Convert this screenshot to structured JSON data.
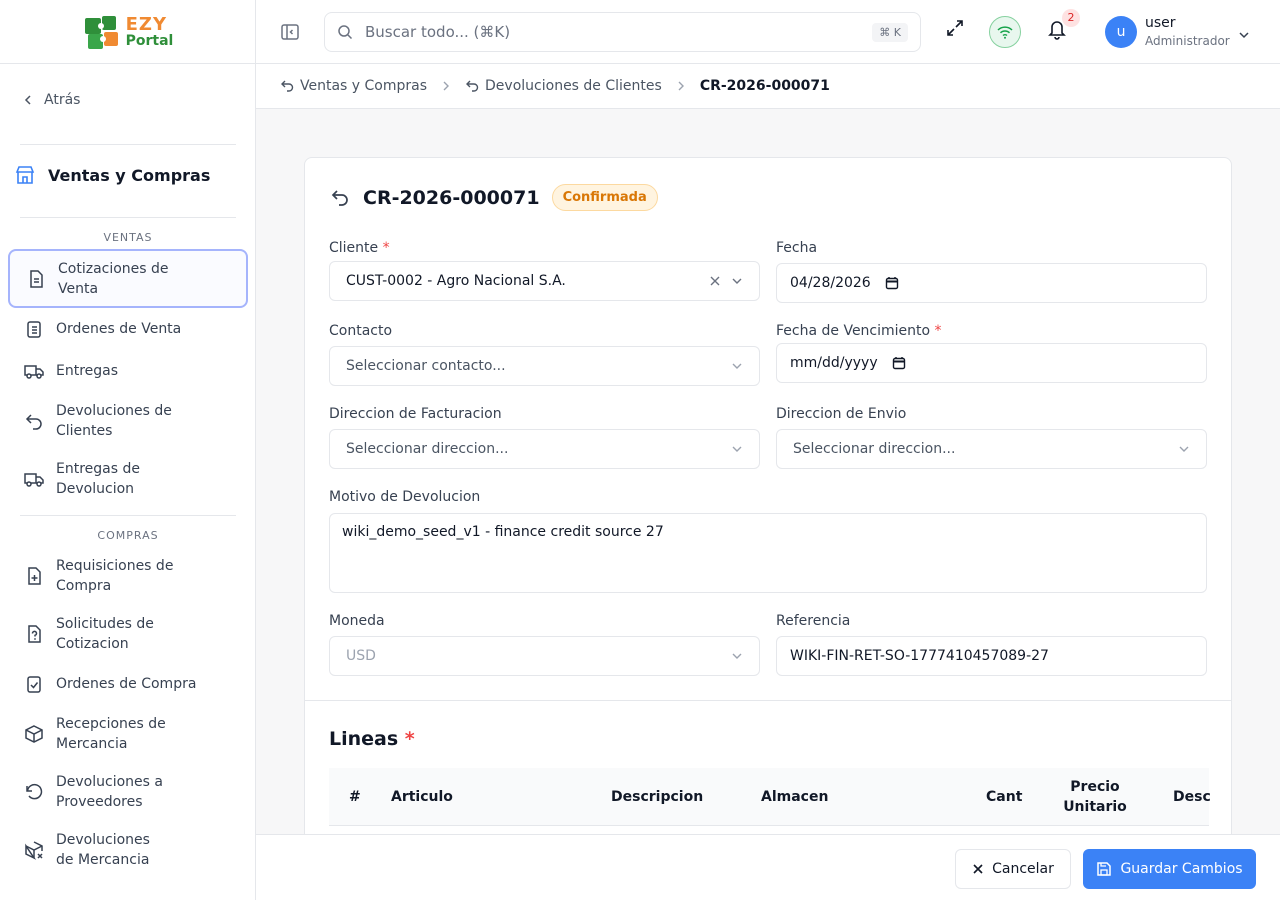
{
  "brand": {
    "line1": "EZY",
    "line2": "Portal"
  },
  "sidebar": {
    "back_label": "Atrás",
    "module_title": "Ventas y Compras",
    "group_sales": "VENTAS",
    "group_purchases": "COMPRAS",
    "items": [
      {
        "label": "Cotizaciones de Venta",
        "icon": "document-icon"
      },
      {
        "label": "Ordenes de Venta",
        "icon": "clipboard-list-icon"
      },
      {
        "label": "Entregas",
        "icon": "truck-icon"
      },
      {
        "label": "Devoluciones de Clientes",
        "icon": "undo-icon"
      },
      {
        "label": "Entregas de Devolucion",
        "icon": "truck-icon"
      },
      {
        "label": "Requisiciones de Compra",
        "icon": "file-plus-icon"
      },
      {
        "label": "Solicitudes de Cotizacion",
        "icon": "file-question-icon"
      },
      {
        "label": "Ordenes de Compra",
        "icon": "clipboard-check-icon"
      },
      {
        "label": "Recepciones de Mercancia",
        "icon": "package-icon"
      },
      {
        "label": "Devoluciones a Proveedores",
        "icon": "rotate-ccw-icon"
      },
      {
        "label": "Devoluciones de Mercancia",
        "icon": "package-x-icon"
      }
    ]
  },
  "topbar": {
    "search_placeholder": "Buscar todo... (⌘K)",
    "shortcut": "⌘ K",
    "notifications_count": "2",
    "user_initial": "u",
    "user_name": "user",
    "user_role": "Administrador"
  },
  "breadcrumb": {
    "items": [
      "Ventas y Compras",
      "Devoluciones de Clientes"
    ],
    "current": "CR-2026-000071"
  },
  "form": {
    "title": "CR-2026-000071",
    "status": "Confirmada",
    "required_mark": "*",
    "cliente_label": "Cliente",
    "cliente_value": "CUST-0002 - Agro Nacional S.A.",
    "fecha_label": "Fecha",
    "fecha_value": "04/28/2026",
    "contacto_label": "Contacto",
    "contacto_placeholder": "Seleccionar contacto...",
    "vencimiento_label": "Fecha de Vencimiento",
    "vencimiento_placeholder": "mm/dd/yyyy",
    "facturacion_label": "Direccion de Facturacion",
    "facturacion_placeholder": "Seleccionar direccion...",
    "envio_label": "Direccion de Envio",
    "envio_placeholder": "Seleccionar direccion...",
    "motivo_label": "Motivo de Devolucion",
    "motivo_value": "wiki_demo_seed_v1 - finance credit source 27",
    "moneda_label": "Moneda",
    "moneda_value": "USD",
    "referencia_label": "Referencia",
    "referencia_value": "WIKI-FIN-RET-SO-1777410457089-27"
  },
  "lines": {
    "title": "Lineas",
    "columns": [
      "#",
      "Articulo",
      "Descripcion",
      "Almacen",
      "Cant",
      "Precio Unitario",
      "Desc"
    ]
  },
  "actions": {
    "cancel": "Cancelar",
    "save": "Guardar Cambios"
  },
  "colors": {
    "primary": "#3b82f6",
    "status_text": "#d97706",
    "status_bg": "#fff4e0",
    "required": "#ef4444"
  }
}
